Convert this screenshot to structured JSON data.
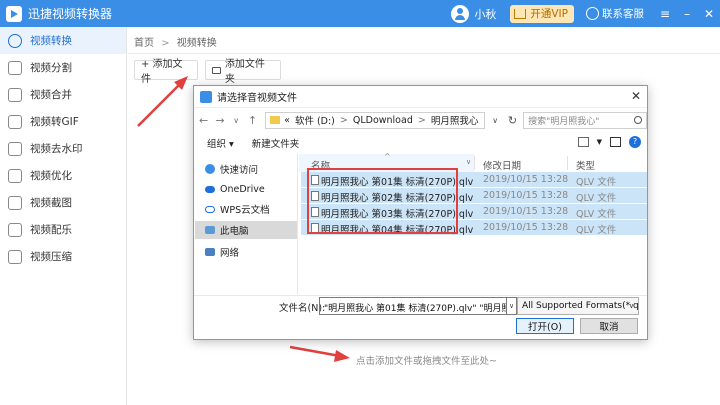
{
  "app": {
    "title": "迅捷视频转换器"
  },
  "header": {
    "username": "小秋",
    "vip_label": "开通VIP",
    "service_label": "联系客服"
  },
  "sidebar": {
    "items": [
      {
        "label": "视频转换",
        "icon": "convert-icon"
      },
      {
        "label": "视频分割",
        "icon": "split-icon"
      },
      {
        "label": "视频合并",
        "icon": "merge-icon"
      },
      {
        "label": "视频转GIF",
        "icon": "gif-icon"
      },
      {
        "label": "视频去水印",
        "icon": "watermark-icon"
      },
      {
        "label": "视频优化",
        "icon": "optimize-icon"
      },
      {
        "label": "视频截图",
        "icon": "screenshot-icon"
      },
      {
        "label": "视频配乐",
        "icon": "music-icon"
      },
      {
        "label": "视频压缩",
        "icon": "compress-icon"
      }
    ]
  },
  "breadcrumb": {
    "home": "首页",
    "sep": ">",
    "current": "视频转换"
  },
  "toolbar": {
    "add_file": "+ 添加文件",
    "add_folder": "添加文件夹"
  },
  "main": {
    "hint": "点击添加文件或拖拽文件至此处~"
  },
  "dialog": {
    "title": "请选择音视频文件",
    "address": {
      "lead": "«",
      "drive": "软件 (D:)",
      "folder1": "QLDownload",
      "folder2": "明月照我心",
      "gt": ">"
    },
    "search_placeholder": "搜索\"明月照我心\"",
    "organize": "组织 ▾",
    "new_folder": "新建文件夹",
    "help": "?",
    "nav": [
      {
        "label": "快速访问"
      },
      {
        "label": "OneDrive"
      },
      {
        "label": "WPS云文档"
      },
      {
        "label": "此电脑"
      },
      {
        "label": "网络"
      }
    ],
    "columns": {
      "name": "名称",
      "date": "修改日期",
      "type": "类型"
    },
    "files": [
      {
        "name": "明月照我心 第01集 标清(270P).qlv",
        "date": "2019/10/15 13:28",
        "type": "QLV 文件"
      },
      {
        "name": "明月照我心 第02集 标清(270P).qlv",
        "date": "2019/10/15 13:28",
        "type": "QLV 文件"
      },
      {
        "name": "明月照我心 第03集 标清(270P).qlv",
        "date": "2019/10/15 13:28",
        "type": "QLV 文件"
      },
      {
        "name": "明月照我心 第04集 标清(270P).qlv",
        "date": "2019/10/15 13:28",
        "type": "QLV 文件"
      }
    ],
    "filename_label": "文件名(N):",
    "filename_value": "\"明月照我心 第01集 标清(270P).qlv\" \"明月照我心",
    "filetype_value": "All Supported Formats(*.qlv",
    "open_label": "打开(O)",
    "cancel_label": "取消"
  },
  "colors": {
    "brand": "#3a8ee6",
    "accent_red": "#e04040",
    "selection": "#cce4f7"
  }
}
